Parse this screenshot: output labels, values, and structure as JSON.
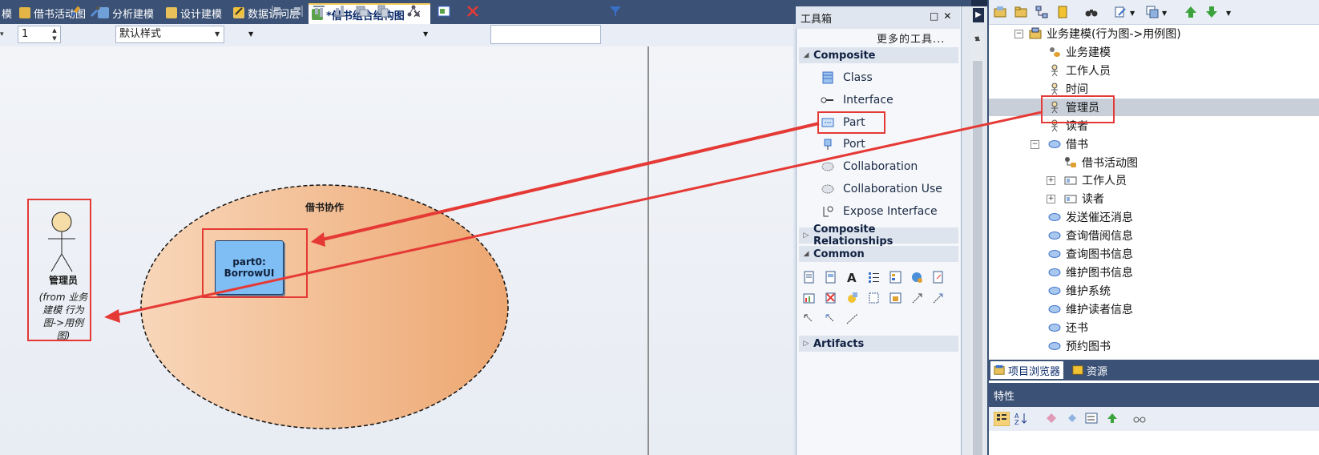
{
  "tabs": [
    {
      "label": "模"
    },
    {
      "label": "借书活动图"
    },
    {
      "label": "分析建模"
    },
    {
      "label": "设计建模"
    },
    {
      "label": "数据访问层"
    },
    {
      "label": "*借书组合结构图",
      "active": true
    }
  ],
  "tab_close": "✕",
  "toolbar": {
    "spin_value": "1",
    "style_select": "默认样式",
    "filter_value": ""
  },
  "diagram": {
    "collaboration_label": "借书协作",
    "part_line1": "part0:",
    "part_line2": "BorrowUI",
    "actor_name": "管理员",
    "actor_from": "(from 业务建模 行为图->用例图)"
  },
  "toolbox": {
    "title": "工具箱",
    "more_tools": "更多的工具...",
    "sections": {
      "composite": "Composite",
      "composite_relationships": "Composite Relationships",
      "common": "Common",
      "artifacts": "Artifacts"
    },
    "composite_items": [
      {
        "label": "Class",
        "icon": "class-icon"
      },
      {
        "label": "Interface",
        "icon": "interface-icon"
      },
      {
        "label": "Part",
        "icon": "part-icon"
      },
      {
        "label": "Port",
        "icon": "port-icon"
      },
      {
        "label": "Collaboration",
        "icon": "collaboration-icon"
      },
      {
        "label": "Collaboration Use",
        "icon": "collaboration-use-icon"
      },
      {
        "label": "Expose Interface",
        "icon": "expose-interface-icon"
      }
    ]
  },
  "browser": {
    "tree": [
      {
        "label": "业务建模(行为图->用例图)",
        "icon": "package-icon"
      },
      {
        "label": "业务建模",
        "icon": "use-case-diagram-icon"
      },
      {
        "label": "工作人员",
        "icon": "actor-icon"
      },
      {
        "label": "时间",
        "icon": "actor-icon"
      },
      {
        "label": "管理员",
        "icon": "actor-icon",
        "selected": true
      },
      {
        "label": "读者",
        "icon": "actor-icon"
      },
      {
        "label": "借书",
        "icon": "use-case-icon"
      },
      {
        "label": "借书活动图",
        "icon": "activity-diagram-icon"
      },
      {
        "label": "工作人员",
        "icon": "part-icon"
      },
      {
        "label": "读者",
        "icon": "part-icon"
      },
      {
        "label": "发送催还消息",
        "icon": "use-case-icon"
      },
      {
        "label": "查询借阅信息",
        "icon": "use-case-icon"
      },
      {
        "label": "查询图书信息",
        "icon": "use-case-icon"
      },
      {
        "label": "维护图书信息",
        "icon": "use-case-icon"
      },
      {
        "label": "维护系统",
        "icon": "use-case-icon"
      },
      {
        "label": "维护读者信息",
        "icon": "use-case-icon"
      },
      {
        "label": "还书",
        "icon": "use-case-icon"
      },
      {
        "label": "预约图书",
        "icon": "use-case-icon"
      }
    ],
    "tabs": [
      {
        "label": "项目浏览器",
        "active": true
      },
      {
        "label": "资源"
      }
    ],
    "properties_title": "特性"
  },
  "colors": {
    "annotation_red": "#e53935",
    "collab_fill_start": "#f8d6b9",
    "collab_fill_end": "#eda771",
    "part_fill": "#7fbdf5",
    "actor_head": "#f6dca6"
  }
}
